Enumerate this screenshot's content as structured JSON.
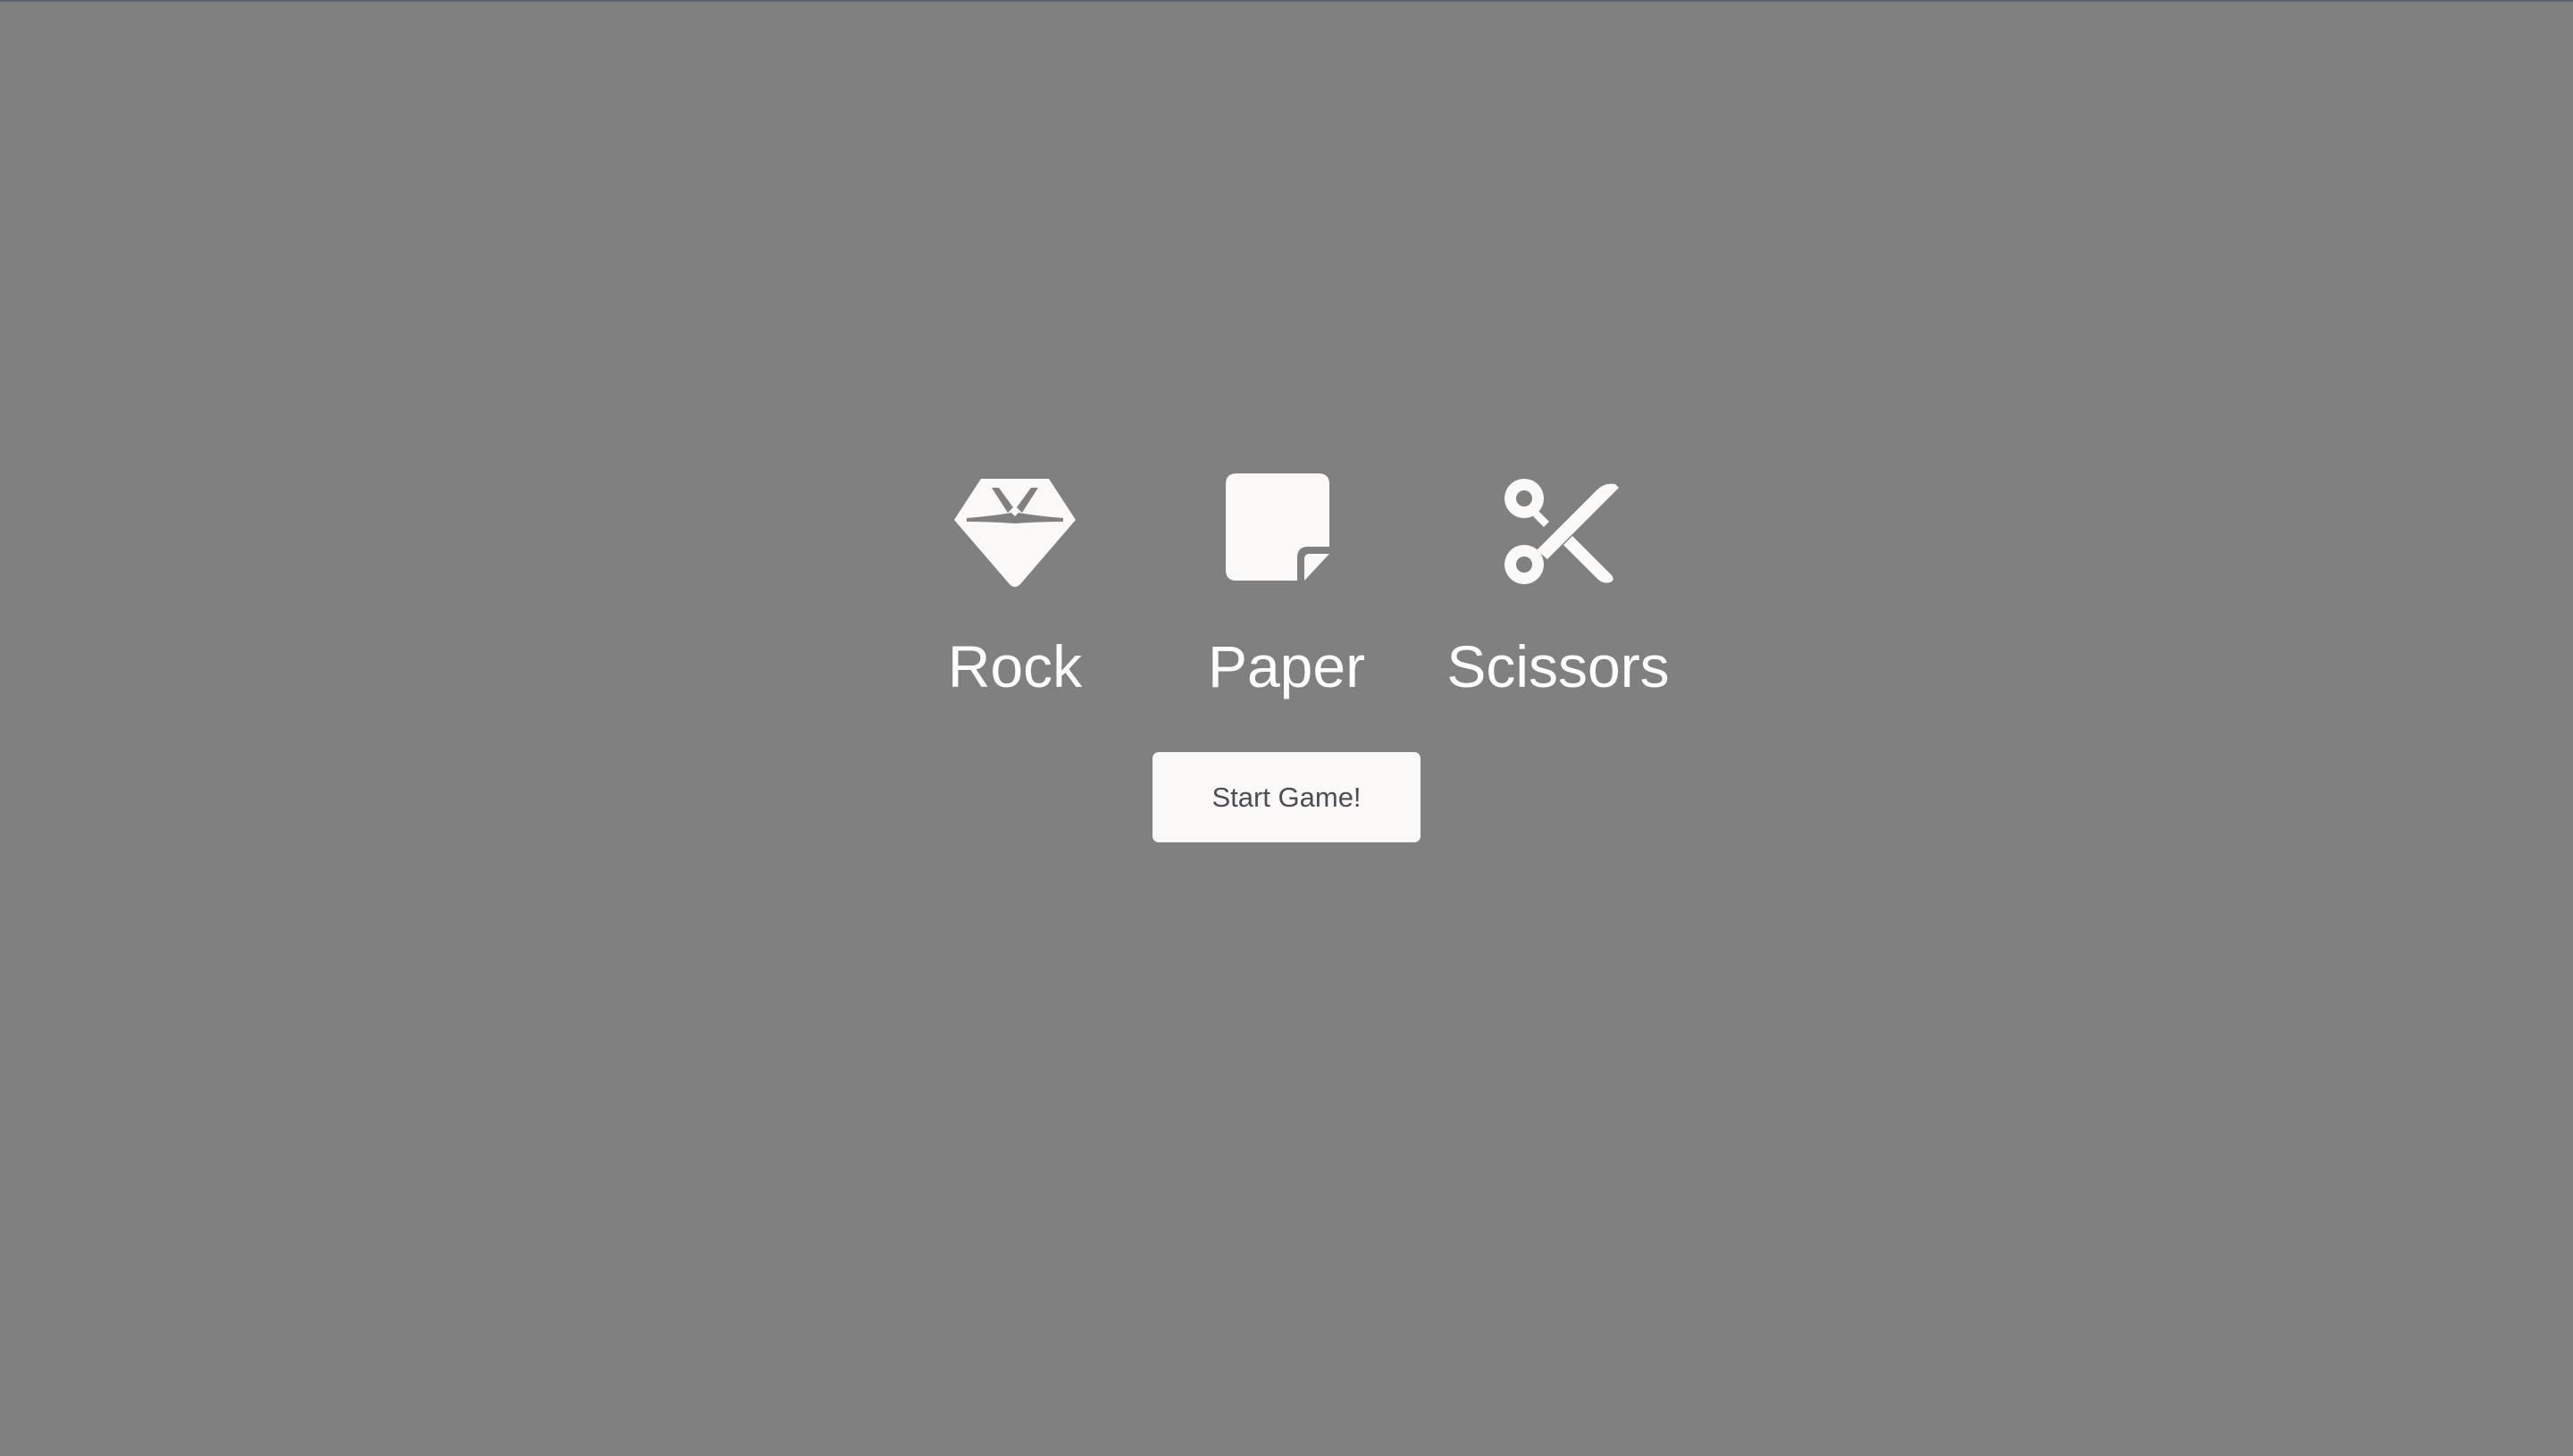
{
  "choices": [
    {
      "label": "Rock",
      "icon": "gem-icon"
    },
    {
      "label": "Paper",
      "icon": "sticky-note-icon"
    },
    {
      "label": "Scissors",
      "icon": "scissors-icon"
    }
  ],
  "start_button": {
    "label": "Start Game!"
  },
  "colors": {
    "background": "#808080",
    "icon": "#fbf9f8",
    "label_text": "#ffffff",
    "button_bg": "#fbf9f8",
    "button_text": "#4d4d55"
  }
}
